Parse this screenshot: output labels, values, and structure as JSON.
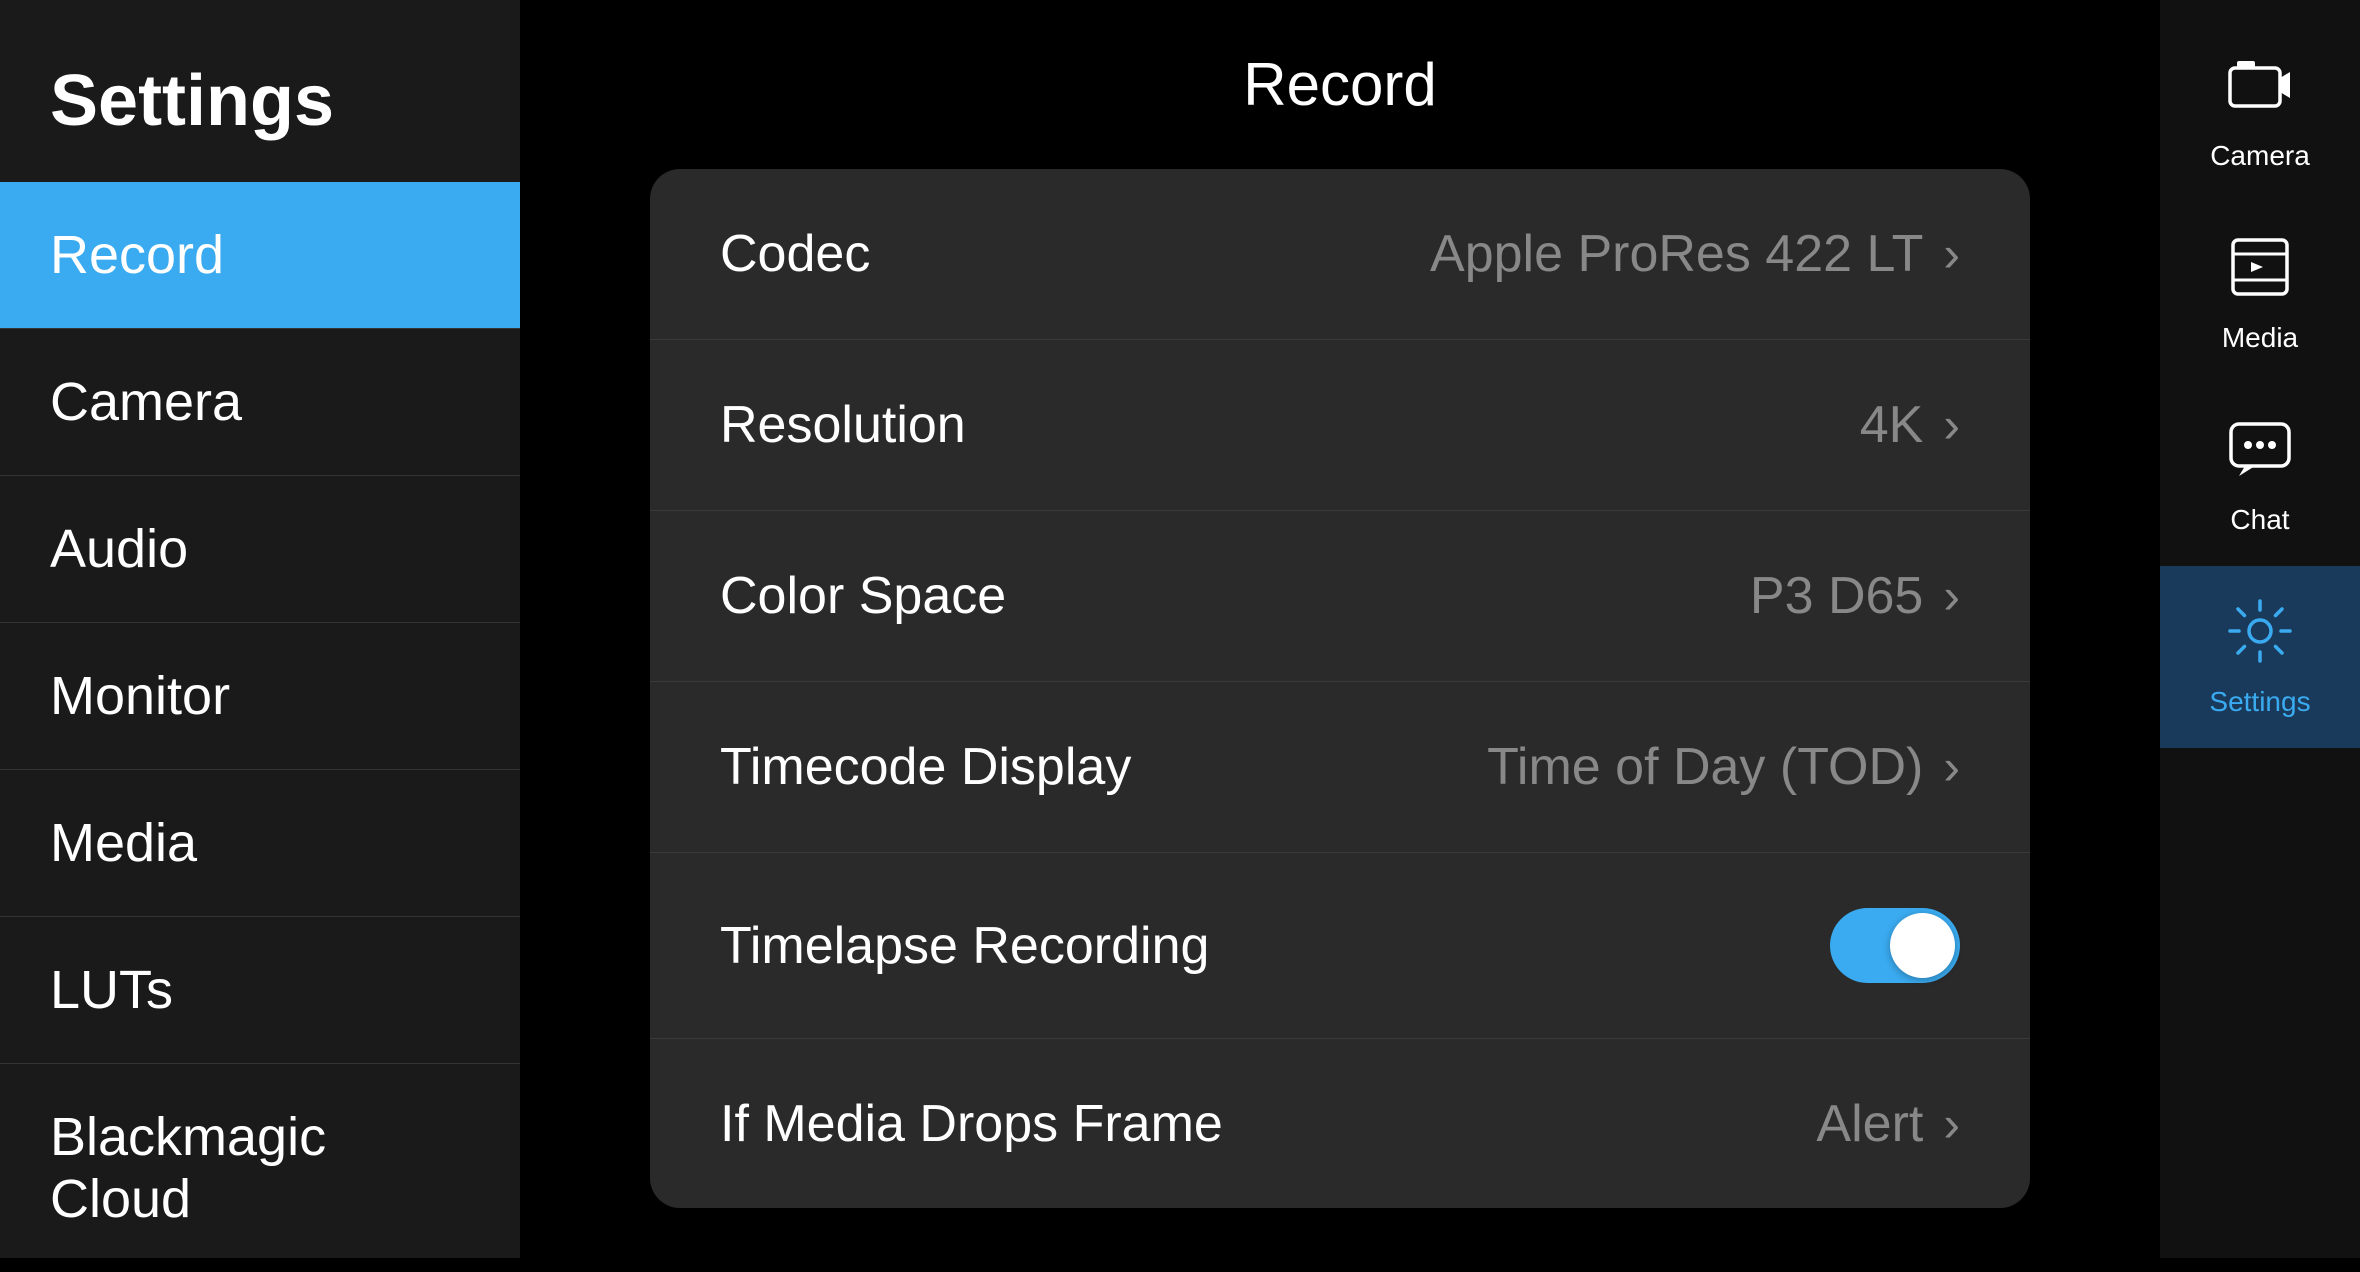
{
  "sidebar": {
    "title": "Settings",
    "items": [
      {
        "id": "record",
        "label": "Record",
        "active": true
      },
      {
        "id": "camera",
        "label": "Camera",
        "active": false
      },
      {
        "id": "audio",
        "label": "Audio",
        "active": false
      },
      {
        "id": "monitor",
        "label": "Monitor",
        "active": false
      },
      {
        "id": "media",
        "label": "Media",
        "active": false
      },
      {
        "id": "luts",
        "label": "LUTs",
        "active": false
      },
      {
        "id": "blackmagic-cloud",
        "label": "Blackmagic Cloud",
        "active": false
      }
    ]
  },
  "main": {
    "title": "Record",
    "settings": [
      {
        "id": "codec",
        "label": "Codec",
        "value": "Apple ProRes 422 LT",
        "type": "chevron"
      },
      {
        "id": "resolution",
        "label": "Resolution",
        "value": "4K",
        "type": "chevron"
      },
      {
        "id": "color-space",
        "label": "Color Space",
        "value": "P3 D65",
        "type": "chevron"
      },
      {
        "id": "timecode-display",
        "label": "Timecode Display",
        "value": "Time of Day (TOD)",
        "type": "chevron"
      },
      {
        "id": "timelapse-recording",
        "label": "Timelapse Recording",
        "value": "",
        "type": "toggle",
        "toggled": true
      },
      {
        "id": "if-media-drops-frame",
        "label": "If Media Drops Frame",
        "value": "Alert",
        "type": "chevron"
      }
    ]
  },
  "right_nav": {
    "items": [
      {
        "id": "camera",
        "label": "Camera",
        "active": false,
        "icon": "camera"
      },
      {
        "id": "media",
        "label": "Media",
        "active": false,
        "icon": "media"
      },
      {
        "id": "chat",
        "label": "Chat",
        "active": false,
        "icon": "chat"
      },
      {
        "id": "settings",
        "label": "Settings",
        "active": true,
        "icon": "settings"
      }
    ]
  }
}
